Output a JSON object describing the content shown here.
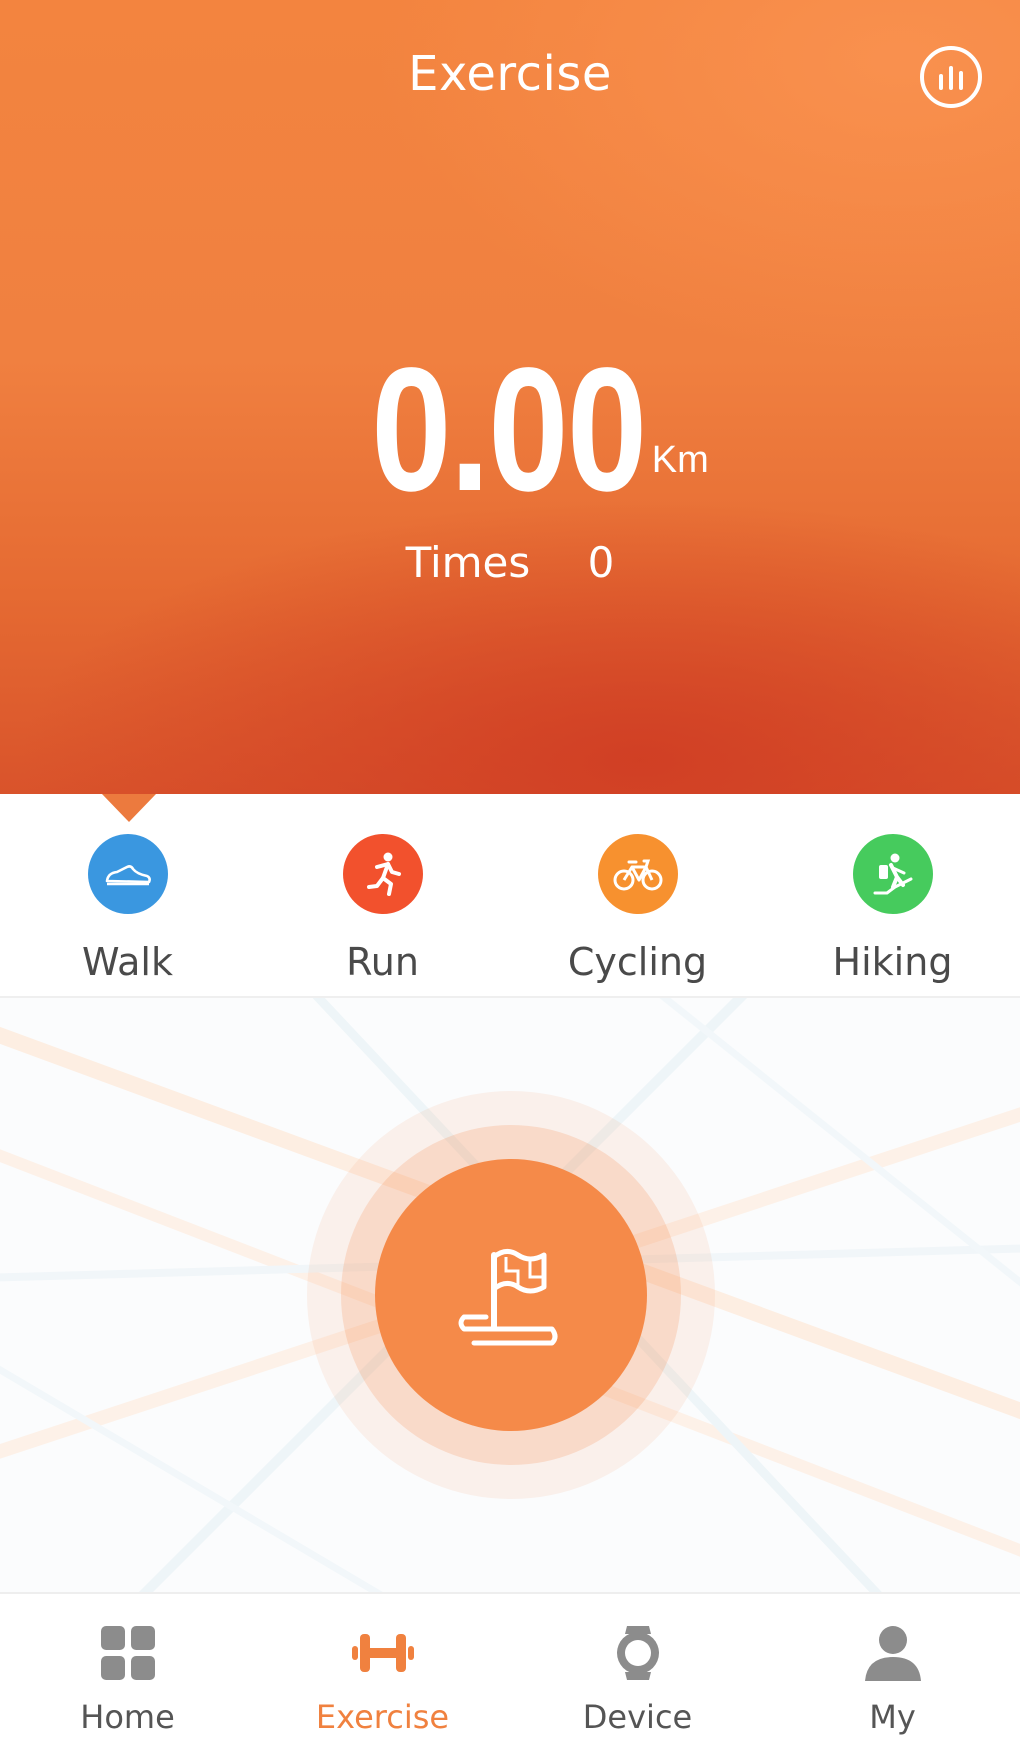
{
  "header": {
    "title": "Exercise",
    "distance_value": "0.00",
    "distance_unit": "Km",
    "times_label": "Times",
    "times_value": "0"
  },
  "activities": [
    {
      "label": "Walk",
      "icon": "shoe-icon",
      "color": "#3a97e0",
      "selected": true
    },
    {
      "label": "Run",
      "icon": "runner-icon",
      "color": "#f2512d",
      "selected": false
    },
    {
      "label": "Cycling",
      "icon": "bicycle-icon",
      "color": "#f7912f",
      "selected": false
    },
    {
      "label": "Hiking",
      "icon": "hiker-icon",
      "color": "#46cb5d",
      "selected": false
    }
  ],
  "start_button": {
    "icon": "flag-icon",
    "color": "#f58a49"
  },
  "bottom_nav": [
    {
      "label": "Home",
      "icon": "grid-icon",
      "active": false
    },
    {
      "label": "Exercise",
      "icon": "dumbbell-icon",
      "active": true
    },
    {
      "label": "Device",
      "icon": "watch-icon",
      "active": false
    },
    {
      "label": "My",
      "icon": "person-icon",
      "active": false
    }
  ],
  "colors": {
    "accent": "#f0813f",
    "inactive": "#8c8c8c"
  }
}
